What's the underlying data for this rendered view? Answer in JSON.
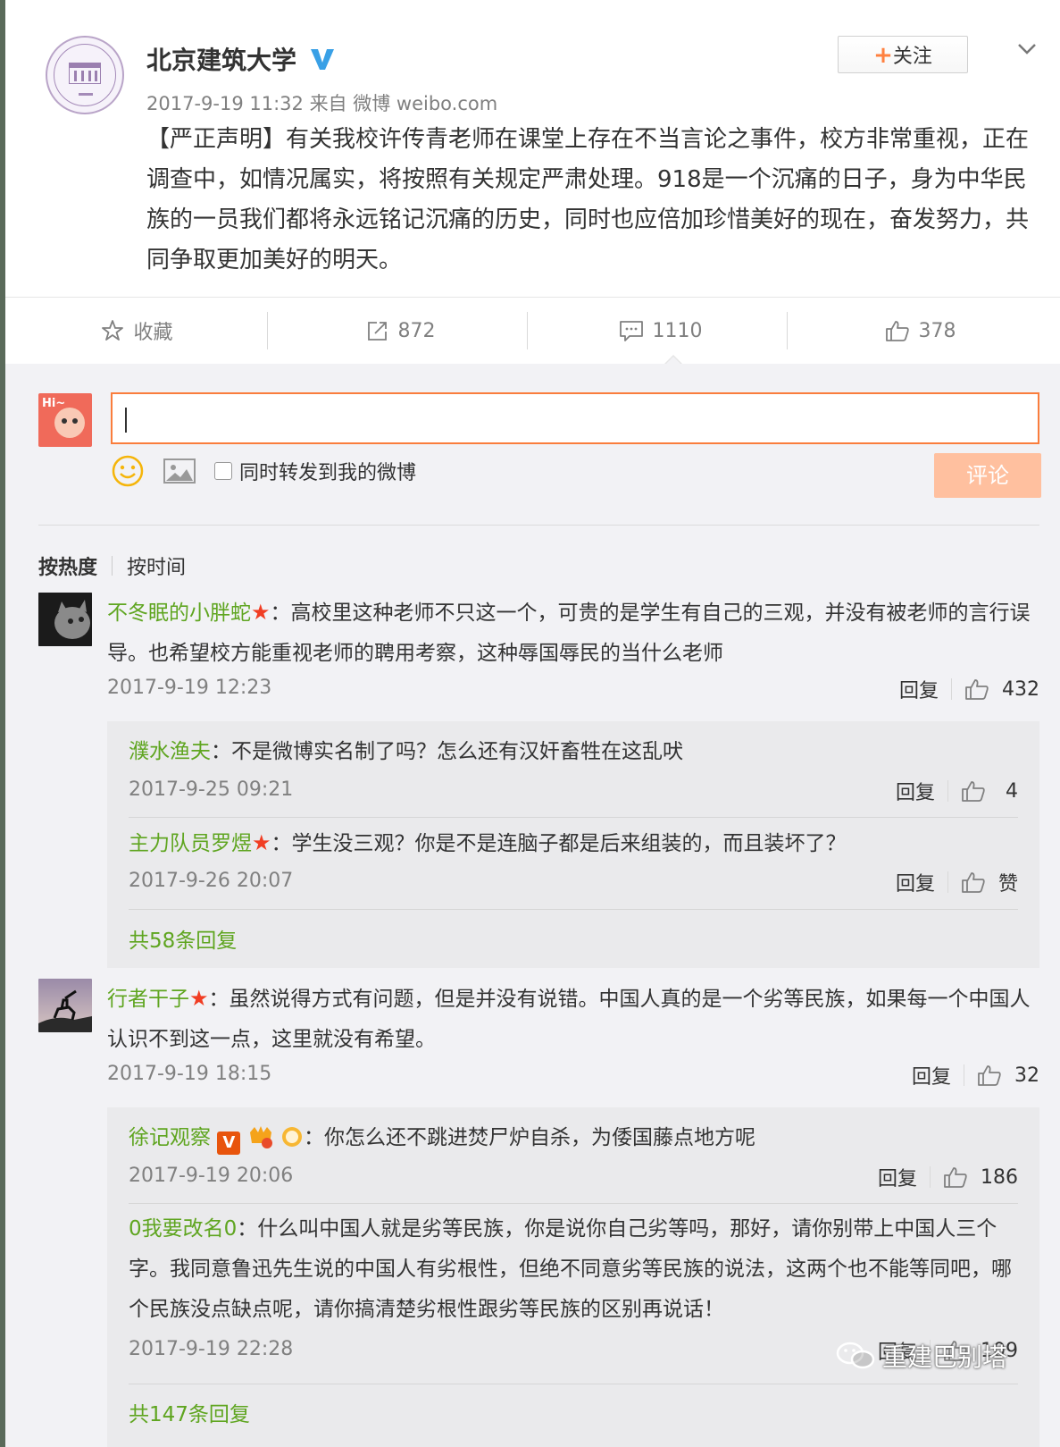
{
  "post": {
    "author": "北京建筑大学",
    "time": "2017-9-19 11:32",
    "source": "来自 微博 weibo.com",
    "body": "【严正声明】有关我校许传青老师在课堂上存在不当言论之事件，校方非常重视，正在调查中，如情况属实，将按照有关规定严肃处理。918是一个沉痛的日子，身为中华民族的一员我们都将永远铭记沉痛的历史，同时也应倍加珍惜美好的现在，奋发努力，共同争取更加美好的明天。",
    "follow_label": "关注",
    "follow_plus": "+"
  },
  "actions": {
    "favorite": "收藏",
    "repost": "872",
    "comment": "1110",
    "like": "378"
  },
  "composer": {
    "avatar_text": "Hi~",
    "repost_option": "同时转发到我的微博",
    "submit": "评论"
  },
  "sort": {
    "hot": "按热度",
    "time": "按时间"
  },
  "comments": [
    {
      "user": "不冬眠的小胖蛇",
      "star": "★",
      "sep": "：",
      "text": "高校里这种老师不只这一个，可贵的是学生有自己的三观，并没有被老师的言行误导。也希望校方能重视老师的聘用考察，这种辱国辱民的当什么老师",
      "time": "2017-9-19 12:23",
      "reply": "回复",
      "likes": "432",
      "replies": [
        {
          "user": "濮水渔夫",
          "sep": "：",
          "text": "不是微博实名制了吗？怎么还有汉奸畜牲在这乱吠",
          "time": "2017-9-25 09:21",
          "reply": "回复",
          "likes": "4"
        },
        {
          "user": "主力队员罗煜",
          "star": "★",
          "sep": "：",
          "text": "学生没三观？你是不是连脑子都是后来组装的，而且装坏了？",
          "time": "2017-9-26 20:07",
          "reply": "回复",
          "likes": "赞"
        }
      ],
      "more": "共58条回复"
    },
    {
      "user": "行者干子",
      "star": "★",
      "sep": "：",
      "text": "虽然说得方式有问题，但是并没有说错。中国人真的是一个劣等民族，如果每一个中国人认识不到这一点，这里就没有希望。",
      "time": "2017-9-19 18:15",
      "reply": "回复",
      "likes": "32",
      "replies": [
        {
          "user": "徐记观察",
          "badge_v": "V",
          "sep": "：",
          "text": "你怎么还不跳进焚尸炉自杀，为倭国藤点地方呢",
          "time": "2017-9-19 20:06",
          "reply": "回复",
          "likes": "186"
        },
        {
          "user": "0我要改名0",
          "sep": "：",
          "text": "什么叫中国人就是劣等民族，你是说你自己劣等吗，那好，请你别带上中国人三个字。我同意鲁迅先生说的中国人有劣根性，但绝不同意劣等民族的说法，这两个也不能等同吧，哪个民族没点缺点呢，请你搞清楚劣根性跟劣等民族的区别再说话！",
          "time": "2017-9-19 22:28",
          "reply": "回复",
          "likes": "109"
        }
      ],
      "more": "共147条回复"
    }
  ],
  "watermark": "重建巴别塔",
  "colors": {
    "accent": "#ff8140",
    "username": "#5fa520",
    "star": "#f13d23",
    "input_border": "#fa7d3c",
    "submit_disabled": "#ffc09f"
  }
}
